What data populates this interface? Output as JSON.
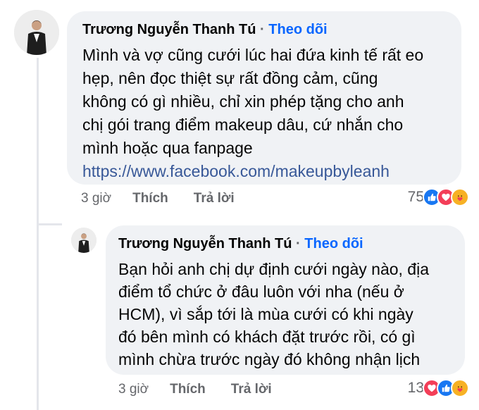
{
  "comment": {
    "author": "Trương Nguyễn Thanh Tú",
    "separator": "·",
    "follow_label": "Theo dõi",
    "text_lines": [
      "Mình và vợ cũng cưới lúc hai đứa kinh tế rất eo",
      "hẹp, nên đọc thiệt sự rất đồng cảm, cũng",
      "không có gì nhiều, chỉ xin phép tặng cho anh",
      "chị gói trang điểm makeup dâu, cứ nhắn cho",
      "mình hoặc qua fanpage"
    ],
    "link": "https://www.facebook.com/makeupbyleanh",
    "time": "3 giờ",
    "like_label": "Thích",
    "reply_label": "Trả lời",
    "reaction_count": "75",
    "reactions": [
      "like-icon",
      "love-icon",
      "care-icon"
    ]
  },
  "reply": {
    "author": "Trương Nguyễn Thanh Tú",
    "separator": "·",
    "follow_label": "Theo dõi",
    "text_lines": [
      "Bạn hỏi anh chị dự định cưới ngày nào, địa",
      "điểm tổ chức ở đâu luôn với nha (nếu ở",
      "HCM), vì sắp tới là mùa cưới có khi ngày",
      "đó bên mình có khách đặt trước rồi, có gì",
      "mình chừa trước ngày đó không nhận lịch"
    ],
    "time": "3 giờ",
    "like_label": "Thích",
    "reply_label": "Trả lời",
    "reaction_count": "13",
    "reactions": [
      "love-icon",
      "like-icon",
      "care-icon"
    ]
  },
  "colors": {
    "bubble": "#f0f2f5",
    "follow": "#0866ff",
    "link": "#385898",
    "meta": "#65676b",
    "like": "#1877f2",
    "love": "#f33e58",
    "care": "#f7b125"
  }
}
